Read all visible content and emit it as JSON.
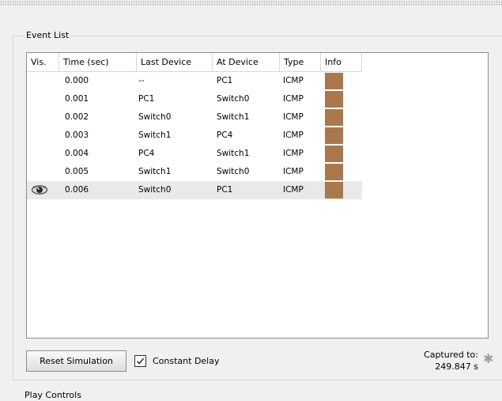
{
  "event_list": {
    "title": "Event List",
    "columns": [
      {
        "label": "Vis."
      },
      {
        "label": "Time (sec)"
      },
      {
        "label": "Last Device"
      },
      {
        "label": "At Device"
      },
      {
        "label": "Type"
      },
      {
        "label": "Info"
      }
    ],
    "rows": [
      {
        "visible": false,
        "time": "0.000",
        "last_device": "--",
        "at_device": "PC1",
        "type": "ICMP",
        "info_color": "#aa784d",
        "selected": false
      },
      {
        "visible": false,
        "time": "0.001",
        "last_device": "PC1",
        "at_device": "Switch0",
        "type": "ICMP",
        "info_color": "#aa784d",
        "selected": false
      },
      {
        "visible": false,
        "time": "0.002",
        "last_device": "Switch0",
        "at_device": "Switch1",
        "type": "ICMP",
        "info_color": "#aa784d",
        "selected": false
      },
      {
        "visible": false,
        "time": "0.003",
        "last_device": "Switch1",
        "at_device": "PC4",
        "type": "ICMP",
        "info_color": "#aa784d",
        "selected": false
      },
      {
        "visible": false,
        "time": "0.004",
        "last_device": "PC4",
        "at_device": "Switch1",
        "type": "ICMP",
        "info_color": "#aa784d",
        "selected": false
      },
      {
        "visible": false,
        "time": "0.005",
        "last_device": "Switch1",
        "at_device": "Switch0",
        "type": "ICMP",
        "info_color": "#aa784d",
        "selected": false
      },
      {
        "visible": true,
        "time": "0.006",
        "last_device": "Switch0",
        "at_device": "PC1",
        "type": "ICMP",
        "info_color": "#aa784d",
        "selected": true
      }
    ]
  },
  "controls": {
    "reset_label": "Reset Simulation",
    "constant_delay_label": "Constant Delay",
    "constant_delay_checked": true,
    "captured_label": "Captured to:",
    "captured_value": "249.847 s"
  },
  "next_group": {
    "title": "Play Controls"
  }
}
